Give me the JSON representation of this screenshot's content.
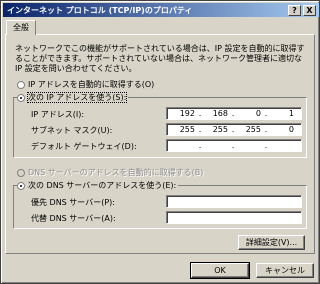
{
  "window": {
    "title": "インターネット プロトコル (TCP/IP)のプロパティ",
    "help_btn": "?",
    "close_btn": "X"
  },
  "tab": {
    "label": "全般"
  },
  "description": "ネットワークでこの機能がサポートされている場合は、IP 設定を自動的に取得することができます。サポートされていない場合は、ネットワーク管理者に適切な IP 設定を問い合わせてください。",
  "ip_mode": {
    "auto_label": "IP アドレスを自動的に取得する(O)",
    "manual_label": "次の IP アドレスを使う(S):",
    "selected": "manual"
  },
  "ip_fields": {
    "ip_label": "IP アドレス(I):",
    "ip_value": [
      "192",
      "168",
      "0",
      "1"
    ],
    "mask_label": "サブネット マスク(U):",
    "mask_value": [
      "255",
      "255",
      "255",
      "0"
    ],
    "gateway_label": "デフォルト ゲートウェイ(D):",
    "gateway_value": [
      "",
      "",
      "",
      ""
    ],
    "dot": "."
  },
  "dns_mode": {
    "auto_label": "DNS サーバーのアドレスを自動的に取得する(B)",
    "manual_label": "次の DNS サーバーのアドレスを使う(E):",
    "selected": "manual"
  },
  "dns_fields": {
    "preferred_label": "優先 DNS サーバー(P):",
    "alternate_label": "代替 DNS サーバー(A):"
  },
  "buttons": {
    "advanced": "詳細設定(V)...",
    "ok": "OK",
    "cancel": "キャンセル"
  }
}
